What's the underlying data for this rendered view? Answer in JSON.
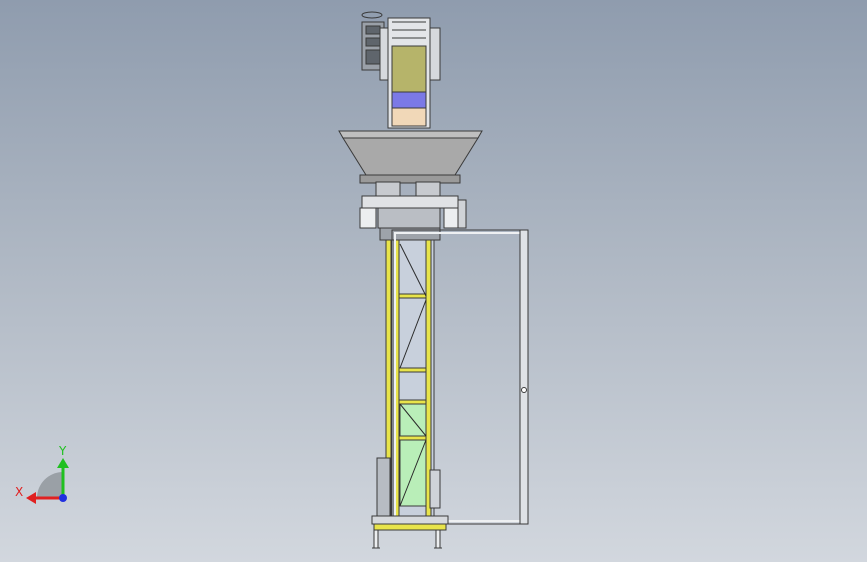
{
  "viewport": {
    "background_top": "#8f9cae",
    "background_bottom": "#d2d7de"
  },
  "model": {
    "frame_color": "#e8e44a",
    "outline_color": "#3a3a3a",
    "hopper_color": "#a9a9a9",
    "panel_olive": "#b6b46a",
    "panel_blue": "#7b79e6",
    "panel_peach": "#f1d8b8",
    "panel_green": "#b9eeb8"
  },
  "triad": {
    "x_label": "X",
    "y_label": "Y",
    "x_color": "#e02020",
    "y_color": "#20c020",
    "z_color": "#2030e0",
    "sphere_icon": "sphere-quarter-icon"
  }
}
